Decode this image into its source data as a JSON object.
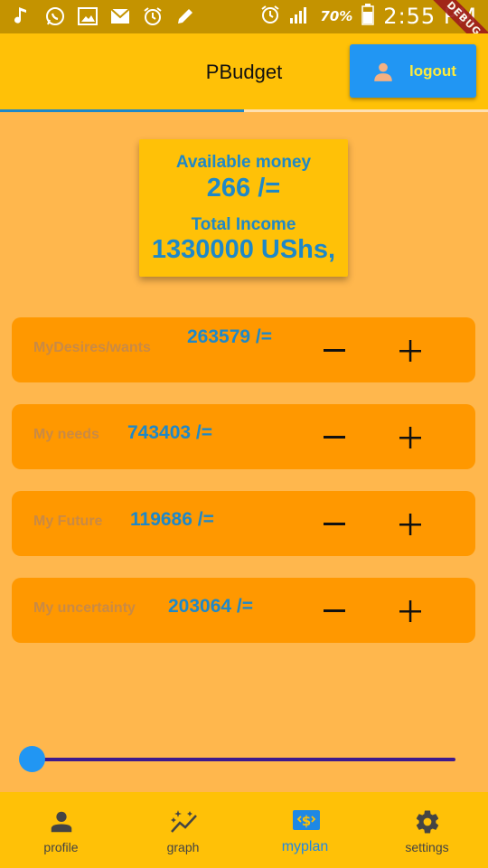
{
  "status_bar": {
    "battery_percent": "70%",
    "time": "2:55 PM",
    "debug_label": "DEBUG",
    "left_icons": [
      "music-note-icon",
      "whatsapp-icon",
      "image-icon",
      "mail-icon",
      "alarm-icon",
      "pencil-icon"
    ],
    "right_icons": [
      "alarm-icon",
      "signal-icon",
      "battery-icon"
    ]
  },
  "app_bar": {
    "title": "PBudget",
    "logout_label": "logout",
    "logout_icon": "person-icon",
    "active_tab_fraction": 0.5
  },
  "summary": {
    "available_label": "Available money",
    "available_value": "266 /=",
    "income_label": "Total Income",
    "income_value": "1330000 UShs,"
  },
  "categories": [
    {
      "name": "MyDesires/wants",
      "value": "263579 /="
    },
    {
      "name": "My needs",
      "value": "743403 /="
    },
    {
      "name": "My Future",
      "value": "119686 /="
    },
    {
      "name": "My uncertainty",
      "value": "203064 /="
    }
  ],
  "slider": {
    "value": 0
  },
  "bottom_nav": {
    "items": [
      {
        "label": "profile",
        "icon": "person-icon"
      },
      {
        "label": "graph",
        "icon": "auto-graph-icon"
      },
      {
        "label": "myplan",
        "icon": "money-icon",
        "active": true
      },
      {
        "label": "settings",
        "icon": "gear-icon"
      }
    ]
  },
  "colors": {
    "status_bar": "#C49300",
    "app_bar": "#FFC107",
    "background": "#FFB74D",
    "row": "#FF9800",
    "accent_blue": "#2196F3",
    "value_blue": "#1E88C8",
    "logout_text": "#FFEB3B"
  }
}
